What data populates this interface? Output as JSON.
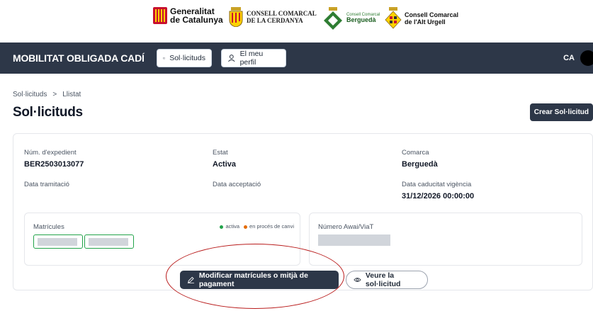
{
  "logos": {
    "generalitat": [
      "Generalitat",
      "de Catalunya"
    ],
    "cerdanya": [
      "CONSELL COMARCAL",
      "DE LA CERDANYA"
    ],
    "bergueda": [
      "Consell Comarcal",
      "Berguedà"
    ],
    "urgell": [
      "Consell Comarcal",
      "de l'Alt Urgell"
    ]
  },
  "header": {
    "app_title": "MOBILITAT OBLIGADA CADÍ",
    "nav_sollicituds": "Sol·licituds",
    "nav_perfil": "El meu perfil",
    "lang": "CA"
  },
  "breadcrumb": {
    "root": "Sol·licituds",
    "separator": ">",
    "current": "Llistat"
  },
  "page_title": "Sol·licituds",
  "create_button": "Crear Sol·licitud",
  "details": {
    "expedient_label": "Núm. d'expedient",
    "expedient_value": "BER2503013077",
    "estat_label": "Estat",
    "estat_value": "Activa",
    "comarca_label": "Comarca",
    "comarca_value": "Berguedà",
    "tramitacio_label": "Data tramitació",
    "acceptacio_label": "Data acceptació",
    "caducitat_label": "Data caducitat vigència",
    "caducitat_value": "31/12/2026 00:00:00"
  },
  "matricules": {
    "label": "Matrícules",
    "legend_active": "activa",
    "legend_change": "en procés de canvi"
  },
  "awai": {
    "label": "Número Awai/ViaT"
  },
  "actions": {
    "modify": "Modificar matrícules o mitjà de pagament",
    "view": "Veure la sol·licitud"
  },
  "colors": {
    "header_bg": "#2d3748",
    "active": "#22a34a",
    "in_change": "#e46c0a",
    "annotation": "#b91c1c"
  }
}
